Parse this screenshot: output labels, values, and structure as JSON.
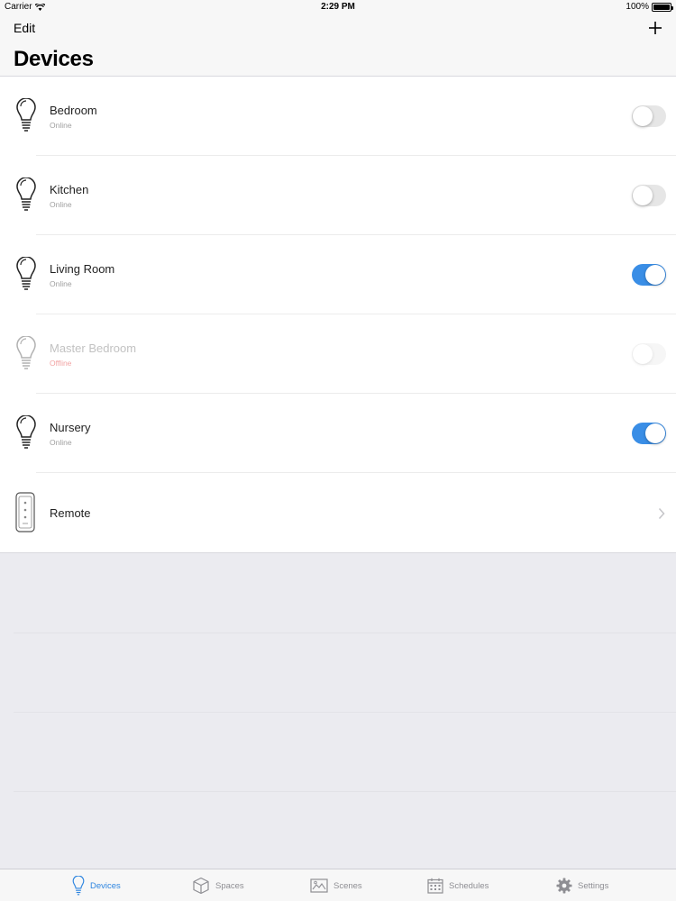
{
  "status_bar": {
    "carrier": "Carrier",
    "time": "2:29 PM",
    "battery": "100%"
  },
  "nav": {
    "edit_label": "Edit",
    "title": "Devices",
    "add_icon": "plus-icon"
  },
  "devices": [
    {
      "name": "Bedroom",
      "status": "Online",
      "icon": "lightbulb-icon",
      "toggle_on": false,
      "offline": false
    },
    {
      "name": "Kitchen",
      "status": "Online",
      "icon": "lightbulb-icon",
      "toggle_on": false,
      "offline": false
    },
    {
      "name": "Living Room",
      "status": "Online",
      "icon": "lightbulb-icon",
      "toggle_on": true,
      "offline": false
    },
    {
      "name": "Master Bedroom",
      "status": "Offline",
      "icon": "lightbulb-icon",
      "toggle_on": false,
      "offline": true
    },
    {
      "name": "Nursery",
      "status": "Online",
      "icon": "lightbulb-icon",
      "toggle_on": true,
      "offline": false
    },
    {
      "name": "Remote",
      "icon": "remote-icon",
      "accessory": "chevron-right-icon"
    }
  ],
  "tabs": [
    {
      "label": "Devices",
      "icon": "lightbulb-icon",
      "active": true
    },
    {
      "label": "Spaces",
      "icon": "cube-icon",
      "active": false
    },
    {
      "label": "Scenes",
      "icon": "picture-icon",
      "active": false
    },
    {
      "label": "Schedules",
      "icon": "calendar-icon",
      "active": false
    },
    {
      "label": "Settings",
      "icon": "gear-icon",
      "active": false
    }
  ],
  "colors": {
    "accent": "#2f86e0",
    "toggle_on": "#3a8ee6",
    "offline_status": "#f2a4a4",
    "background": "#ebebf0"
  }
}
